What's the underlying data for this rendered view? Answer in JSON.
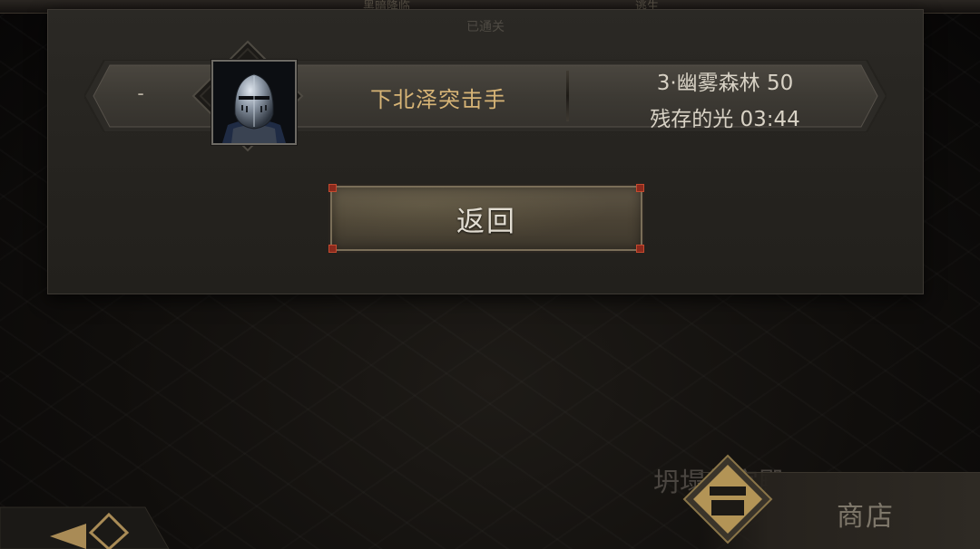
{
  "top_bar": {
    "fragments": [
      "黑暗降临",
      "逃生"
    ]
  },
  "dialog": {
    "title": "已通关",
    "entry": {
      "rank": "-",
      "avatar_icon": "knight-helmet-icon",
      "player_name": "下北泽突击手",
      "stage_line": "3·幽雾森林  50",
      "light_line": "残存的光  03:44"
    },
    "back_button_label": "返回"
  },
  "bottom_hud": {
    "left_nav_icon": "back-arrow-icon",
    "collapse_text": "坍塌的宫殿",
    "shop_icon": "treasure-chest-icon",
    "shop_label": "商店"
  },
  "colors": {
    "accent_gold": "#d7b476",
    "button_corner_red": "#c44a2f",
    "panel_bg": "#2b2925"
  }
}
